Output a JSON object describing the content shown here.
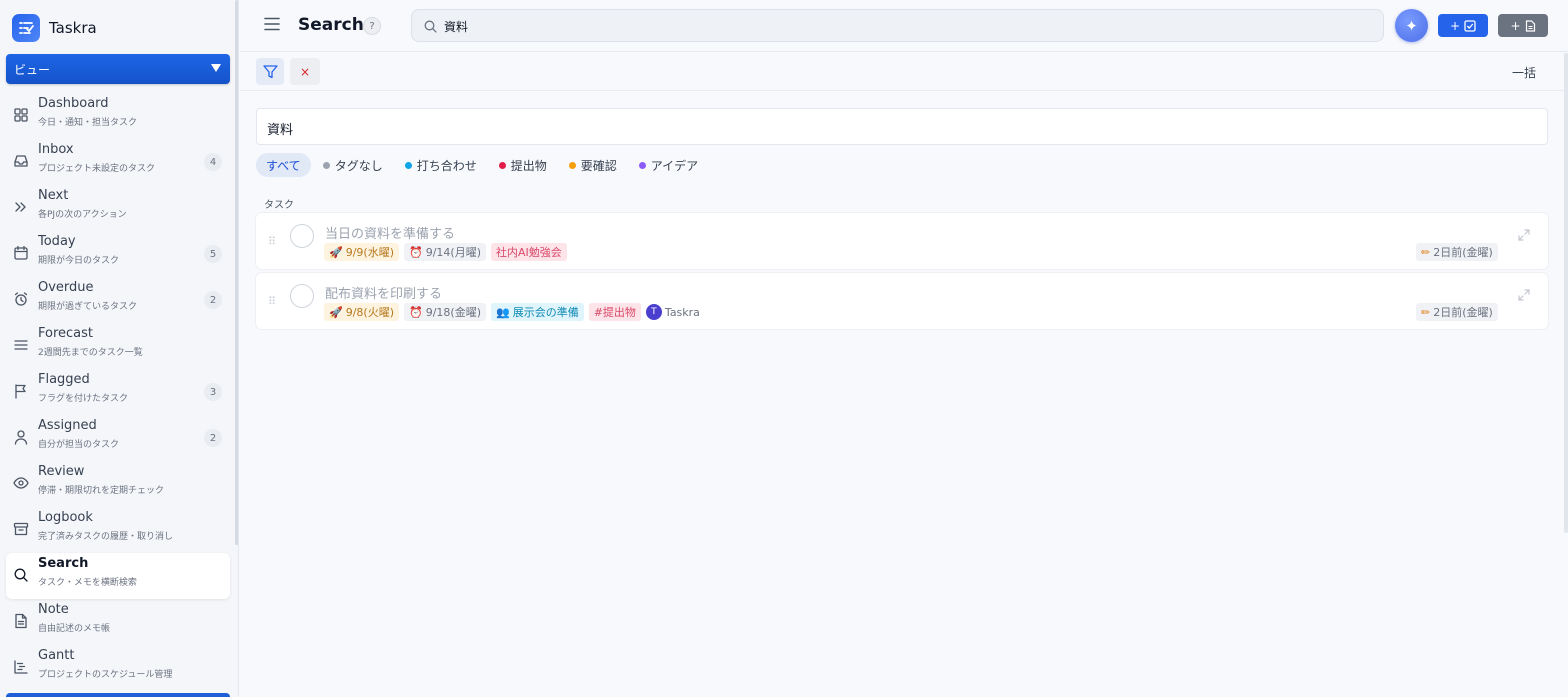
{
  "app": {
    "name": "Taskra"
  },
  "view_select": {
    "label": "ビュー"
  },
  "nav": [
    {
      "id": "dashboard",
      "icon": "grid-icon",
      "title": "Dashboard",
      "sub": "今日・通知・担当タスク",
      "count": null
    },
    {
      "id": "inbox",
      "icon": "inbox-icon",
      "title": "Inbox",
      "sub": "プロジェクト未設定のタスク",
      "count": "4"
    },
    {
      "id": "next",
      "icon": "double-chevron-icon",
      "title": "Next",
      "sub": "各PJの次のアクション",
      "count": null
    },
    {
      "id": "today",
      "icon": "calendar-icon",
      "title": "Today",
      "sub": "期限が今日のタスク",
      "count": "5"
    },
    {
      "id": "overdue",
      "icon": "alarm-icon",
      "title": "Overdue",
      "sub": "期限が過ぎているタスク",
      "count": "2"
    },
    {
      "id": "forecast",
      "icon": "lines-icon",
      "title": "Forecast",
      "sub": "2週間先までのタスク一覧",
      "count": null
    },
    {
      "id": "flagged",
      "icon": "flag-icon",
      "title": "Flagged",
      "sub": "フラグを付けたタスク",
      "count": "3"
    },
    {
      "id": "assigned",
      "icon": "person-icon",
      "title": "Assigned",
      "sub": "自分が担当のタスク",
      "count": "2"
    },
    {
      "id": "review",
      "icon": "eye-icon",
      "title": "Review",
      "sub": "停滞・期限切れを定期チェック",
      "count": null
    },
    {
      "id": "logbook",
      "icon": "archive-icon",
      "title": "Logbook",
      "sub": "完了済みタスクの履歴・取り消し",
      "count": null
    },
    {
      "id": "search",
      "icon": "search-icon",
      "title": "Search",
      "sub": "タスク・メモを横断検索",
      "count": null,
      "active": true
    },
    {
      "id": "note",
      "icon": "document-icon",
      "title": "Note",
      "sub": "自由記述のメモ帳",
      "count": null
    },
    {
      "id": "gantt",
      "icon": "gantt-icon",
      "title": "Gantt",
      "sub": "プロジェクトのスケジュール管理",
      "count": null
    }
  ],
  "header": {
    "title": "Search",
    "help": "?",
    "search_value": "資料",
    "add_task_plus": "+",
    "add_note_plus": "+"
  },
  "toolbar": {
    "clear": "×",
    "bulk": "一括"
  },
  "query": {
    "value": "資料"
  },
  "tag_filters": [
    {
      "label": "すべて",
      "color": null,
      "selected": true
    },
    {
      "label": "タグなし",
      "color": "#9ca3af"
    },
    {
      "label": "打ち合わせ",
      "color": "#0ea5e9"
    },
    {
      "label": "提出物",
      "color": "#e11d48"
    },
    {
      "label": "要確認",
      "color": "#f59e0b"
    },
    {
      "label": "アイデア",
      "color": "#8b5cf6"
    }
  ],
  "section": {
    "label": "タスク"
  },
  "tasks": [
    {
      "title": "当日の資料を準備する",
      "start": "9/9(水曜)",
      "due": "9/14(月曜)",
      "project": "社内AI勉強会",
      "tag": null,
      "assignee": null,
      "modified": "2日前(金曜)"
    },
    {
      "title": "配布資料を印刷する",
      "start": "9/8(火曜)",
      "due": "9/18(金曜)",
      "project": "展示会の準備",
      "tag": "#提出物",
      "assignee": {
        "initial": "T",
        "name": "Taskra"
      },
      "modified": "2日前(金曜)"
    }
  ]
}
